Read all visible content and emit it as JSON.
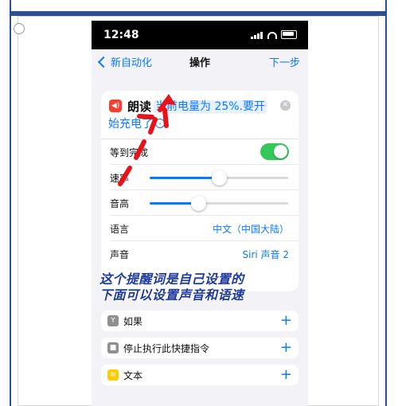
{
  "status_bar": {
    "time": "12:48"
  },
  "header": {
    "back_label": "新自动化",
    "title": "操作",
    "next_label": "下一步"
  },
  "action": {
    "name": "朗读",
    "text_line1": "当前电量为 25%.要开",
    "text_line2": "始充电了",
    "rows": {
      "wait": {
        "label": "等到完成",
        "value": true
      },
      "rate": {
        "label": "速率",
        "level": 0.5
      },
      "pitch": {
        "label": "音高",
        "level": 0.35
      },
      "language": {
        "label": "语言",
        "value": "中文（中国大陆）"
      },
      "voice": {
        "label": "声音",
        "value": "Siri 声音 2"
      }
    }
  },
  "annotation": {
    "line1": "这个提醒词是自己设置的",
    "line2": "下面可以设置声音和语速"
  },
  "suggestions": [
    {
      "label": "如果",
      "icon": "if-icon",
      "color": "#8e8e93"
    },
    {
      "label": "停止执行此快捷指令",
      "icon": "stop-icon",
      "color": "#8e8e93"
    },
    {
      "label": "文本",
      "icon": "text-icon",
      "color": "#ffcc00"
    }
  ],
  "colors": {
    "accent": "#0a7aff",
    "toggle_on": "#34c759",
    "annotation": "#1e3a9e",
    "arrow": "#e8121a"
  }
}
